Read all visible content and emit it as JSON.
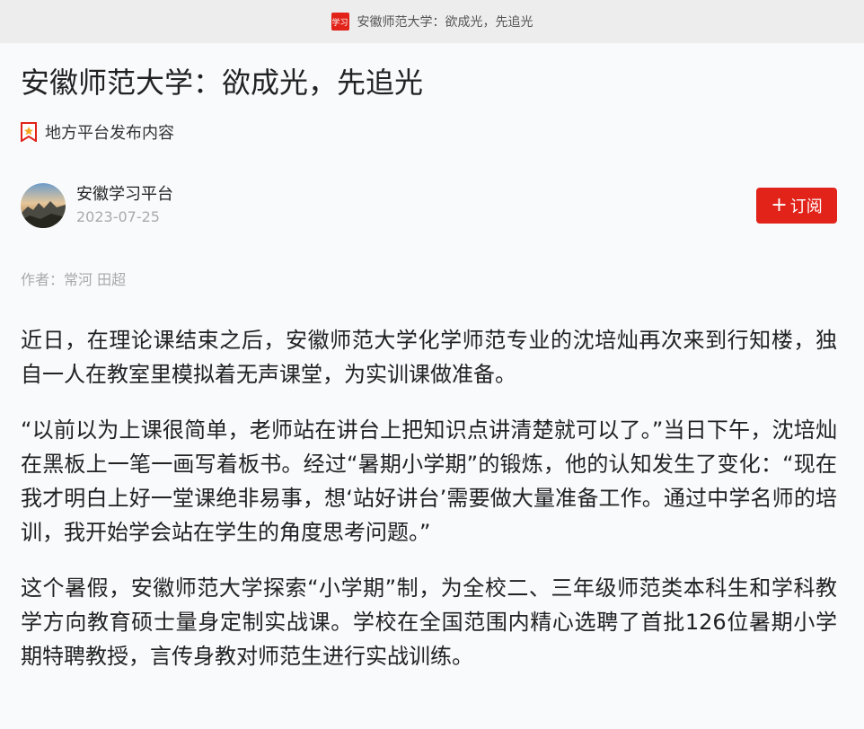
{
  "topbar": {
    "logo_text": "学习",
    "title": "安徽师范大学：欲成光，先追光"
  },
  "article": {
    "title": "安徽师范大学：欲成光，先追光",
    "source_label": "地方平台发布内容",
    "author": {
      "name": "安徽学习平台",
      "date": "2023-07-25"
    },
    "subscribe_label": "订阅",
    "writer": "作者：常河 田超",
    "paragraphs": [
      "近日，在理论课结束之后，安徽师范大学化学师范专业的沈培灿再次来到行知楼，独自一人在教室里模拟着无声课堂，为实训课做准备。",
      "“以前以为上课很简单，老师站在讲台上把知识点讲清楚就可以了。”当日下午，沈培灿在黑板上一笔一画写着板书。经过“暑期小学期”的锻炼，他的认知发生了变化：“现在我才明白上好一堂课绝非易事，想‘站好讲台’需要做大量准备工作。通过中学名师的培训，我开始学会站在学生的角度思考问题。”",
      "这个暑假，安徽师范大学探索“小学期”制，为全校二、三年级师范类本科生和学科教学方向教育硕士量身定制实战课。学校在全国范围内精心选聘了首批126位暑期小学期特聘教授，言传身教对师范生进行实战训练。"
    ]
  },
  "colors": {
    "accent": "#e2231a",
    "topbar_bg": "#ededed",
    "page_bg": "#f9fafc"
  }
}
